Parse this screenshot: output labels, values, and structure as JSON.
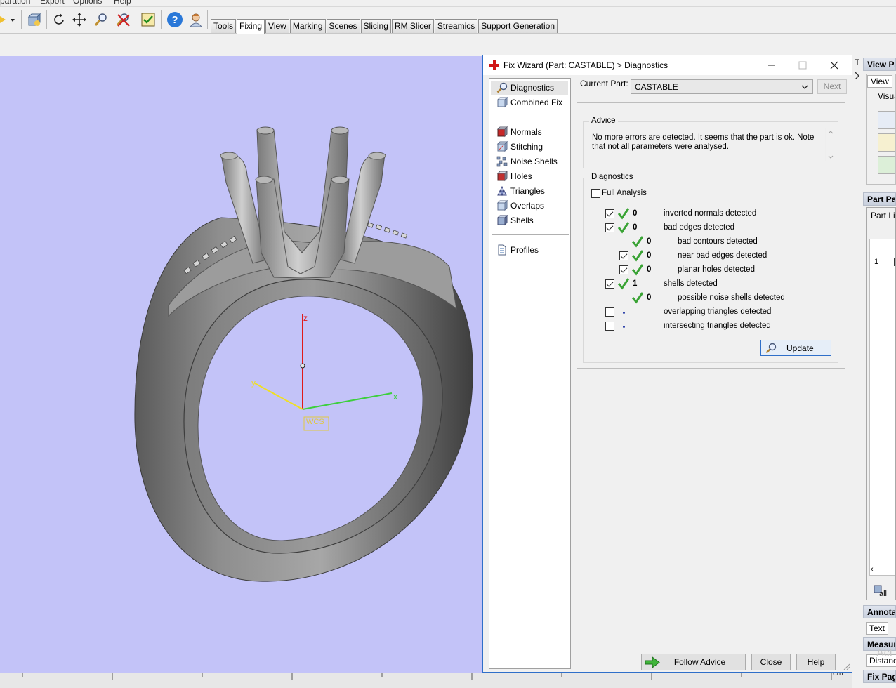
{
  "menubar": {
    "items": [
      "paration",
      "Export",
      "Options",
      "Help"
    ]
  },
  "toolbar": {
    "tabs": [
      "Tools",
      "Fixing",
      "View",
      "Marking",
      "Scenes",
      "Slicing",
      "RM Slicer",
      "Streamics",
      "Support Generation"
    ],
    "active_tab": "Fixing"
  },
  "viewport": {
    "background": "#c3c3f8",
    "axes": {
      "z_label": "z",
      "x_label": "x",
      "y_label": "y",
      "wcs_label": "WCS"
    }
  },
  "dialog": {
    "title": "Fix Wizard (Part: CASTABLE) > Diagnostics",
    "nav": {
      "group1": [
        "Diagnostics",
        "Combined Fix"
      ],
      "group2": [
        "Normals",
        "Stitching",
        "Noise Shells",
        "Holes",
        "Triangles",
        "Overlaps",
        "Shells"
      ],
      "group3": [
        "Profiles"
      ],
      "selected": "Diagnostics"
    },
    "current_part_label": "Current Part:",
    "current_part_value": "CASTABLE",
    "next_label": "Next",
    "advice": {
      "title": "Advice",
      "text": "No more errors are detected. It seems that the part is ok. Note that not all parameters were analysed."
    },
    "diagnostics": {
      "title": "Diagnostics",
      "full_analysis_label": "Full Analysis",
      "full_analysis_checked": false,
      "rows": [
        {
          "label": "inverted normals detected",
          "count": "0",
          "checked": true,
          "status": "ok"
        },
        {
          "label": "bad edges detected",
          "count": "0",
          "checked": true,
          "status": "ok"
        },
        {
          "label": "bad contours detected",
          "count": "0",
          "checked": null,
          "status": "ok"
        },
        {
          "label": "near bad edges detected",
          "count": "0",
          "checked": true,
          "status": "ok"
        },
        {
          "label": "planar holes detected",
          "count": "0",
          "checked": true,
          "status": "ok"
        },
        {
          "label": "shells detected",
          "count": "1",
          "checked": true,
          "status": "ok"
        },
        {
          "label": "possible noise shells detected",
          "count": "0",
          "checked": null,
          "status": "ok"
        },
        {
          "label": "overlapping triangles detected",
          "count": "",
          "checked": false,
          "status": "pending"
        },
        {
          "label": "intersecting triangles detected",
          "count": "",
          "checked": false,
          "status": "pending"
        }
      ],
      "update_label": "Update"
    },
    "buttons": {
      "follow_advice": "Follow Advice",
      "close": "Close",
      "help": "Help"
    }
  },
  "right_panel": {
    "view_pages": "View Pa",
    "view_tab": "View",
    "visual_label": "Visua",
    "part_pages": "Part Pa",
    "part_list": "Part Lis",
    "row_number": "1",
    "all_label": "all",
    "annotations": "Annota",
    "text_tab": "Text",
    "measure": "Measur",
    "distance": "Distanc",
    "fix_pages": "Fix Pag",
    "watermark": "Act"
  },
  "ruler": {
    "unit": "cm"
  },
  "colors": {
    "accent": "#2f6fc9",
    "check_green": "#3aa335",
    "viewport_bg": "#c3c3f8"
  }
}
